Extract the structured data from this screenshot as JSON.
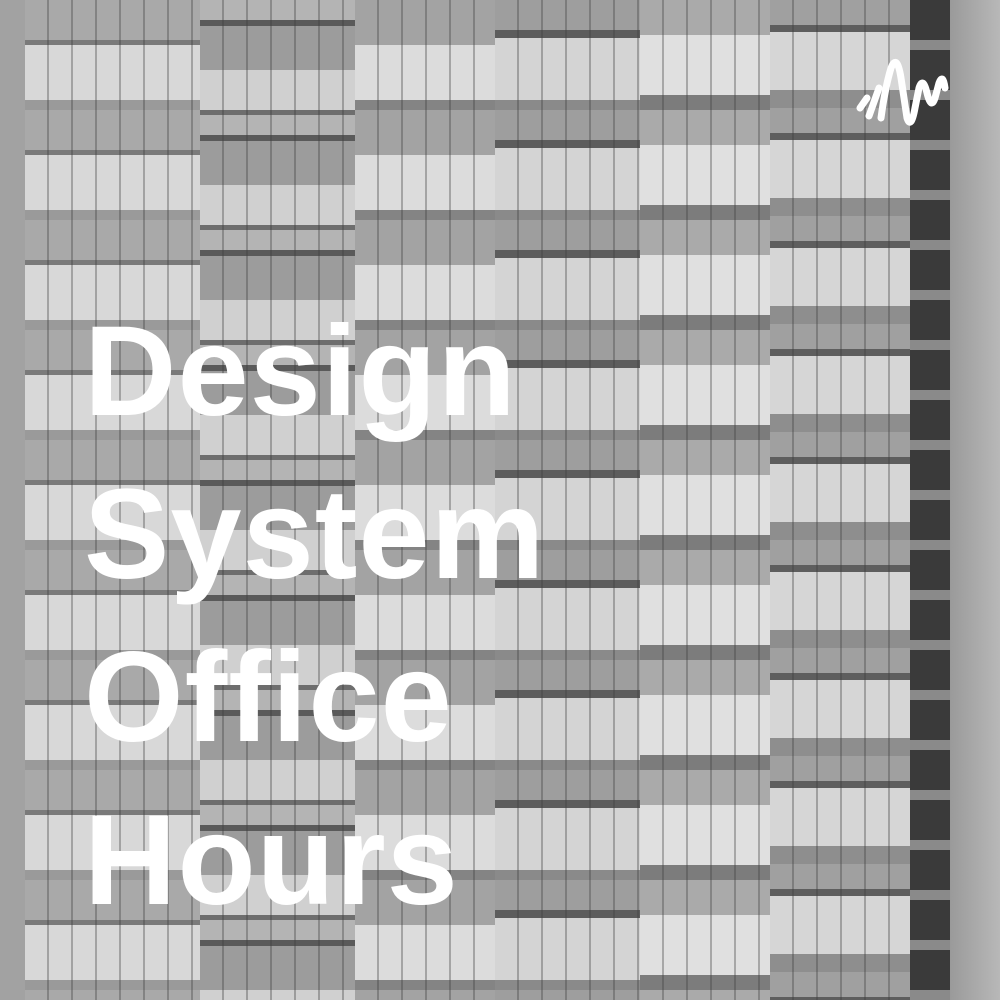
{
  "cover": {
    "title_lines": [
      "Design",
      "System",
      "Office",
      "Hours"
    ],
    "logo_icon": "podcast-waveform-icon",
    "text_color": "#ffffff"
  }
}
